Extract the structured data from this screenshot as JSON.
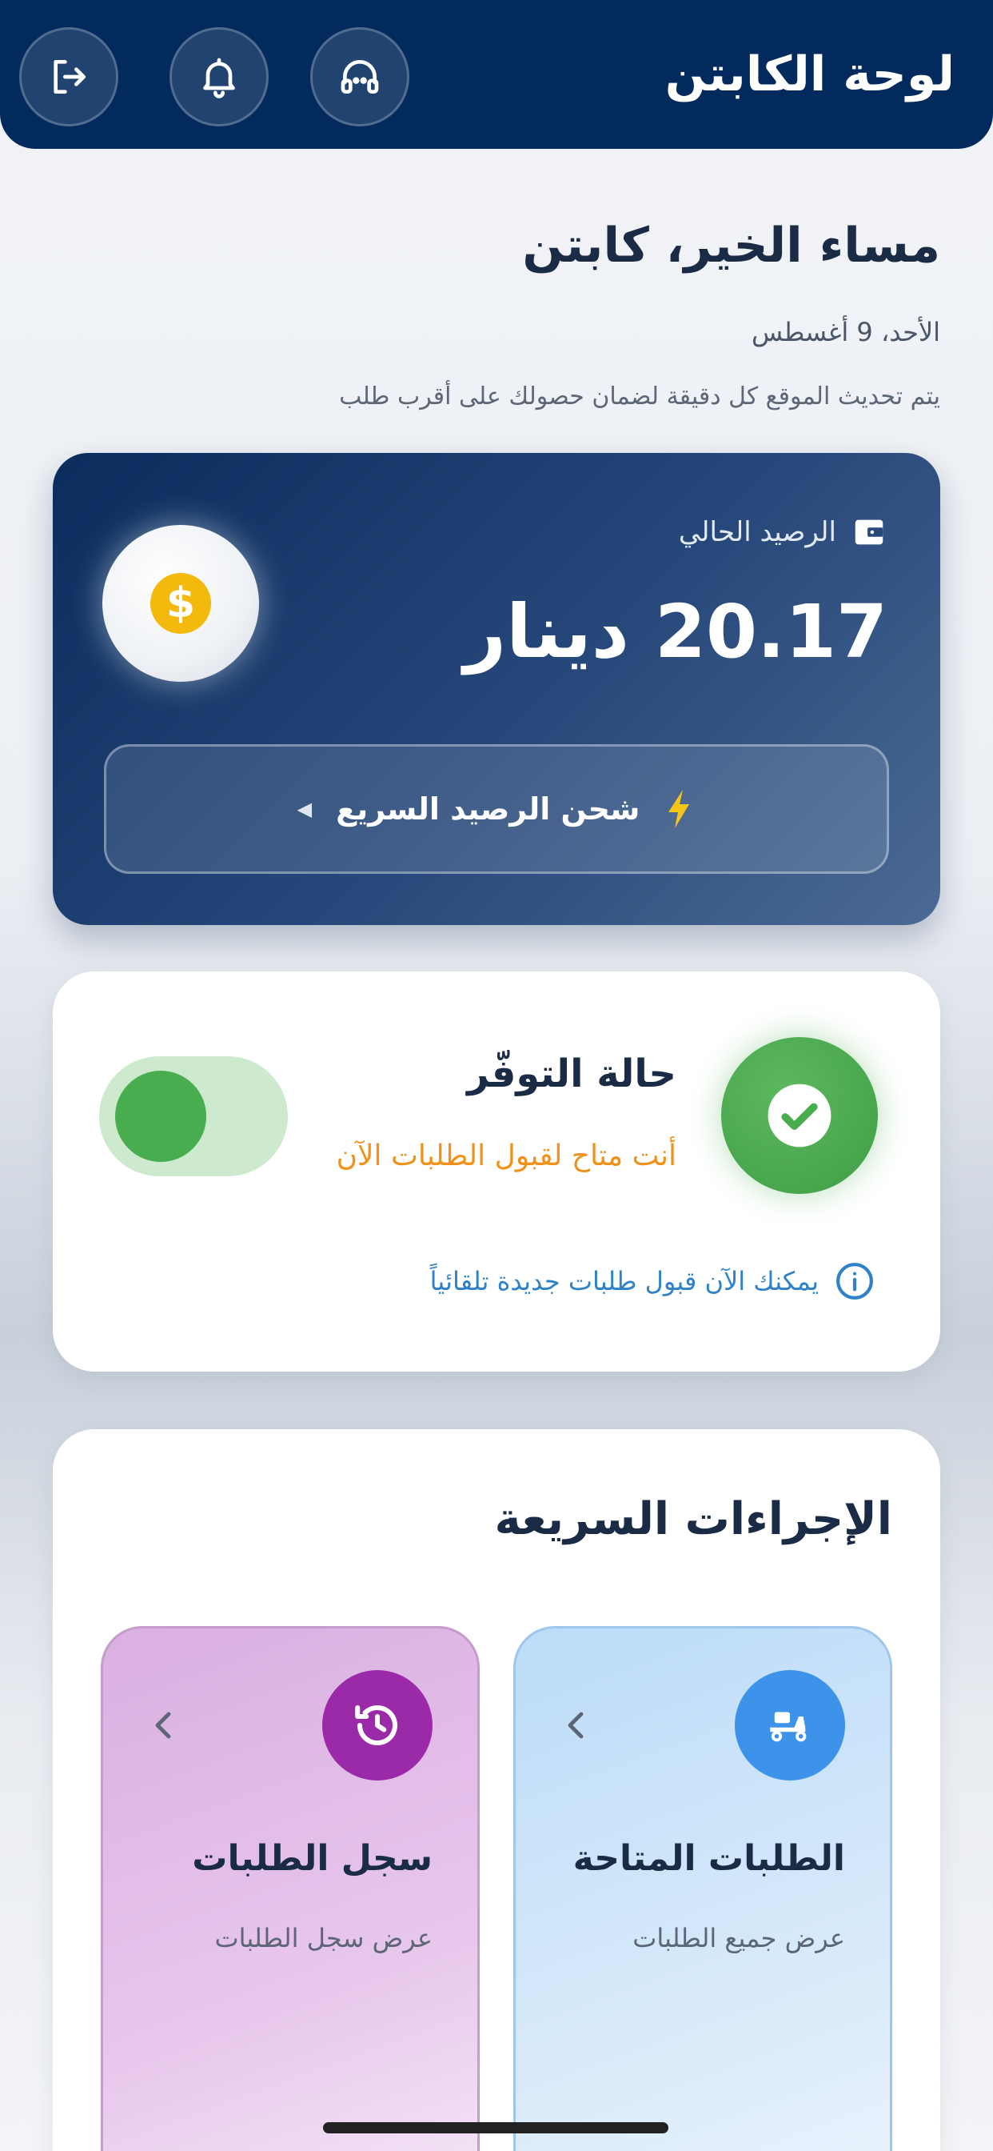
{
  "header": {
    "title": "لوحة الكابتن",
    "buttons": [
      {
        "name": "logout-icon"
      },
      {
        "name": "bell-icon"
      },
      {
        "name": "support-icon"
      }
    ]
  },
  "greeting": {
    "title": "مساء الخير، كابتن",
    "date": "الأحد، 9 أغسطس",
    "hint": "يتم تحديث الموقع كل دقيقة لضمان حصولك على أقرب طلب"
  },
  "balance": {
    "label": "الرصيد الحالي",
    "amount": "20.17 دينار",
    "coin_symbol": "$",
    "recharge_label": "شحن الرصيد السريع",
    "colors": {
      "card": "#0a2d5e",
      "coin": "#f3b90d",
      "bolt": "#f5c518"
    }
  },
  "availability": {
    "title": "حالة التوفّر",
    "status": "أنت متاح لقبول الطلبات الآن",
    "info": "يمكنك الآن قبول طلبات جديدة تلقائياً",
    "toggle_on": true,
    "colors": {
      "status": "#f0911a",
      "info": "#2f82c7",
      "active": "#47ad4e"
    }
  },
  "quick_actions": {
    "title": "الإجراءات السريعة",
    "tiles": [
      {
        "title": "الطلبات المتاحة",
        "subtitle": "عرض جميع الطلبات",
        "icon": "scooter-icon",
        "color": "#3d93ea"
      },
      {
        "title": "سجل الطلبات",
        "subtitle": "عرض سجل الطلبات",
        "icon": "history-icon",
        "color": "#9b2aa8"
      }
    ]
  }
}
